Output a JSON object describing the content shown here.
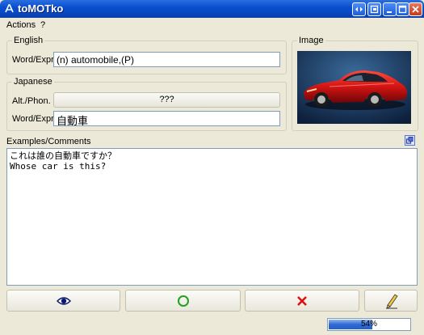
{
  "window": {
    "title": "toMOTko"
  },
  "menu": {
    "items": [
      "Actions",
      "?"
    ]
  },
  "english": {
    "group_label": "English",
    "word_label": "Word/Expr.",
    "word_value": "(n) automobile,(P)"
  },
  "japanese": {
    "group_label": "Japanese",
    "phon_label": "Alt./Phon.",
    "phon_button": "???",
    "word_label": "Word/Expr.",
    "word_value": "自動車"
  },
  "image": {
    "group_label": "Image",
    "subject": "red sports car"
  },
  "examples": {
    "label": "Examples/Comments",
    "lines": [
      "これは誰の自動車ですか？",
      "Whose car is this?"
    ]
  },
  "buttons": {
    "reveal_icon": "eye-icon",
    "correct_icon": "circle-icon",
    "wrong_icon": "cross-icon",
    "edit_icon": "pencil-icon"
  },
  "progress": {
    "value": 0.54,
    "label": "54%"
  },
  "colors": {
    "titlebar": "#0a4fcf",
    "correct": "#22a022",
    "wrong": "#e01010",
    "car": "#d81818"
  }
}
